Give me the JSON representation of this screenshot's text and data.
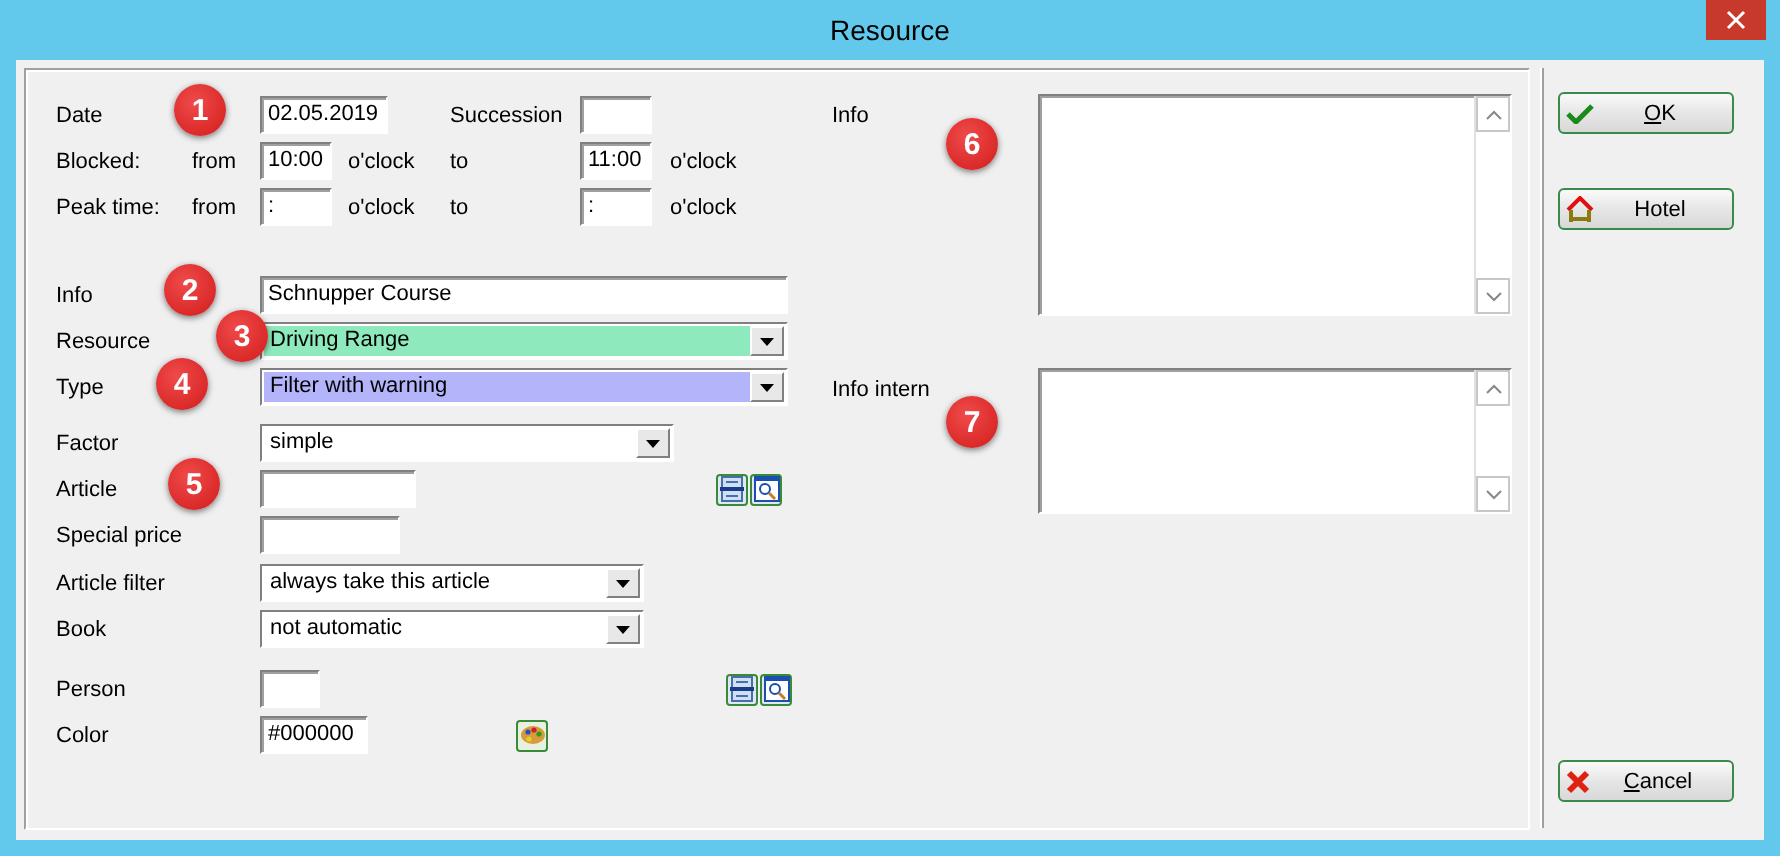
{
  "window": {
    "title": "Resource"
  },
  "form_rows": [
    {
      "kind": "date",
      "label": "Date",
      "value": "02.05.2019",
      "extra_label": "Succession"
    },
    {
      "kind": "time",
      "label": "Blocked:",
      "from_label": "from",
      "from_value": "10:00",
      "from_unit": "o'clock",
      "to_label": "to",
      "to_value": "11:00",
      "to_unit": "o'clock"
    },
    {
      "kind": "time",
      "label": "Peak time:",
      "from_label": "from",
      "from_value": ":",
      "from_unit": "o'clock",
      "to_label": "to",
      "to_value": ":",
      "to_unit": "o'clock"
    },
    {
      "kind": "text",
      "label": "Info",
      "value": "Schnupper Course"
    },
    {
      "kind": "select",
      "label": "Resource",
      "value": "Driving Range",
      "color": "#8eeabc"
    },
    {
      "kind": "select",
      "label": "Type",
      "value": "Filter with warning",
      "color": "#b4b4fa"
    },
    {
      "kind": "select",
      "label": "Factor",
      "value": "simple",
      "color": "#ffffff"
    },
    {
      "kind": "lookup",
      "label": "Article"
    },
    {
      "kind": "text",
      "label": "Special price"
    },
    {
      "kind": "select",
      "label": "Article filter",
      "value": "always take this article",
      "color": "#ffffff"
    },
    {
      "kind": "select",
      "label": "Book",
      "value": "not automatic",
      "color": "#ffffff"
    },
    {
      "kind": "lookup",
      "label": "Person"
    },
    {
      "kind": "color",
      "label": "Color",
      "value": "#000000"
    }
  ],
  "notes": [
    {
      "label": "Info"
    },
    {
      "label": "Info intern"
    }
  ],
  "markers": [
    {
      "number": "1"
    },
    {
      "number": "2"
    },
    {
      "number": "3"
    },
    {
      "number": "4"
    },
    {
      "number": "5"
    },
    {
      "number": "6"
    },
    {
      "number": "7"
    }
  ],
  "buttons": [
    {
      "kind": "ok",
      "label": "OK",
      "underline_first": true
    },
    {
      "kind": "hotel",
      "label": "Hotel"
    },
    {
      "kind": "cancel",
      "label": "Cancel",
      "underline_first": true
    }
  ]
}
